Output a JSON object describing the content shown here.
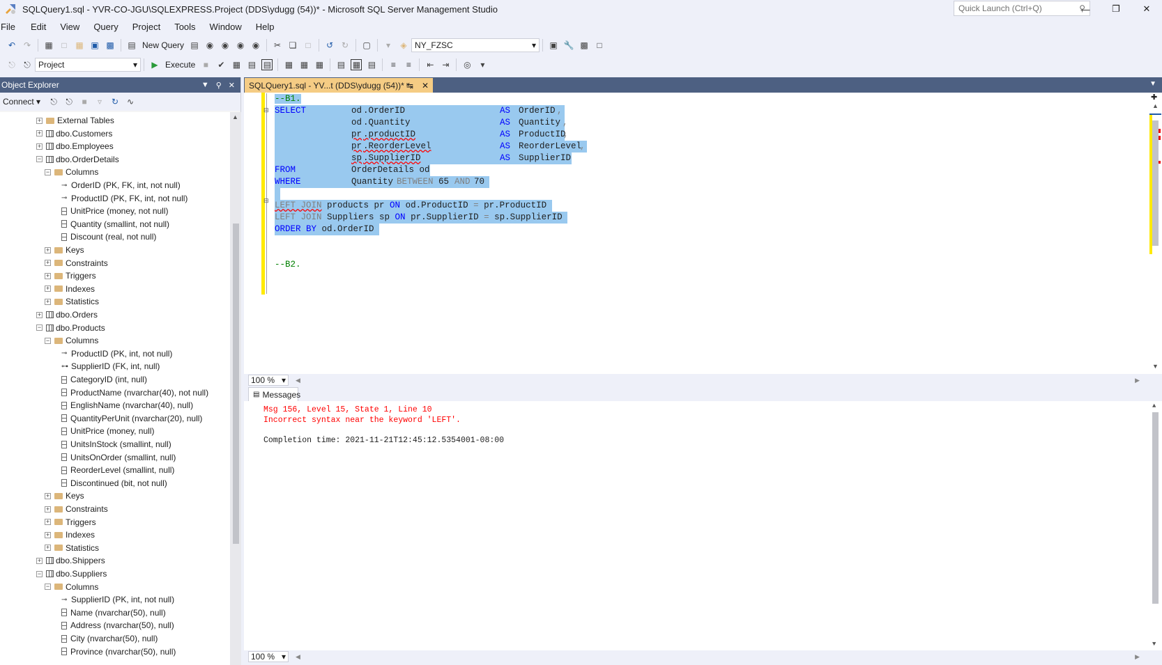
{
  "window": {
    "title": "SQLQuery1.sql - YVR-CO-JGU\\SQLEXPRESS.Project (DDS\\ydugg (54))* - Microsoft SQL Server Management Studio",
    "quick_launch_placeholder": "Quick Launch (Ctrl+Q)"
  },
  "menu": [
    "File",
    "Edit",
    "View",
    "Query",
    "Project",
    "Tools",
    "Window",
    "Help"
  ],
  "toolbar": {
    "new_query_label": "New Query",
    "connection_combo": "NY_FZSC",
    "database_combo": "Project",
    "execute_label": "Execute"
  },
  "object_explorer": {
    "title": "Object Explorer",
    "connect_label": "Connect",
    "tree": [
      {
        "label": "External Tables",
        "level": 1,
        "kind": "folder",
        "state": "+"
      },
      {
        "label": "dbo.Customers",
        "level": 1,
        "kind": "table",
        "state": "+"
      },
      {
        "label": "dbo.Employees",
        "level": 1,
        "kind": "table",
        "state": "+"
      },
      {
        "label": "dbo.OrderDetails",
        "level": 1,
        "kind": "table",
        "state": "-"
      },
      {
        "label": "Columns",
        "level": 2,
        "kind": "folder",
        "state": "-"
      },
      {
        "label": "OrderID (PK, FK, int, not null)",
        "level": 3,
        "kind": "key"
      },
      {
        "label": "ProductID (PK, FK, int, not null)",
        "level": 3,
        "kind": "key"
      },
      {
        "label": "UnitPrice (money, not null)",
        "level": 3,
        "kind": "column"
      },
      {
        "label": "Quantity (smallint, not null)",
        "level": 3,
        "kind": "column"
      },
      {
        "label": "Discount (real, not null)",
        "level": 3,
        "kind": "column"
      },
      {
        "label": "Keys",
        "level": 2,
        "kind": "folder",
        "state": "+"
      },
      {
        "label": "Constraints",
        "level": 2,
        "kind": "folder",
        "state": "+"
      },
      {
        "label": "Triggers",
        "level": 2,
        "kind": "folder",
        "state": "+"
      },
      {
        "label": "Indexes",
        "level": 2,
        "kind": "folder",
        "state": "+"
      },
      {
        "label": "Statistics",
        "level": 2,
        "kind": "folder",
        "state": "+"
      },
      {
        "label": "dbo.Orders",
        "level": 1,
        "kind": "table",
        "state": "+"
      },
      {
        "label": "dbo.Products",
        "level": 1,
        "kind": "table",
        "state": "-"
      },
      {
        "label": "Columns",
        "level": 2,
        "kind": "folder",
        "state": "-"
      },
      {
        "label": "ProductID (PK, int, not null)",
        "level": 3,
        "kind": "key"
      },
      {
        "label": "SupplierID (FK, int, null)",
        "level": 3,
        "kind": "fkey"
      },
      {
        "label": "CategoryID (int, null)",
        "level": 3,
        "kind": "column"
      },
      {
        "label": "ProductName (nvarchar(40), not null)",
        "level": 3,
        "kind": "column"
      },
      {
        "label": "EnglishName (nvarchar(40), null)",
        "level": 3,
        "kind": "column"
      },
      {
        "label": "QuantityPerUnit (nvarchar(20), null)",
        "level": 3,
        "kind": "column"
      },
      {
        "label": "UnitPrice (money, null)",
        "level": 3,
        "kind": "column"
      },
      {
        "label": "UnitsInStock (smallint, null)",
        "level": 3,
        "kind": "column"
      },
      {
        "label": "UnitsOnOrder (smallint, null)",
        "level": 3,
        "kind": "column"
      },
      {
        "label": "ReorderLevel (smallint, null)",
        "level": 3,
        "kind": "column"
      },
      {
        "label": "Discontinued (bit, not null)",
        "level": 3,
        "kind": "column"
      },
      {
        "label": "Keys",
        "level": 2,
        "kind": "folder",
        "state": "+"
      },
      {
        "label": "Constraints",
        "level": 2,
        "kind": "folder",
        "state": "+"
      },
      {
        "label": "Triggers",
        "level": 2,
        "kind": "folder",
        "state": "+"
      },
      {
        "label": "Indexes",
        "level": 2,
        "kind": "folder",
        "state": "+"
      },
      {
        "label": "Statistics",
        "level": 2,
        "kind": "folder",
        "state": "+"
      },
      {
        "label": "dbo.Shippers",
        "level": 1,
        "kind": "table",
        "state": "+"
      },
      {
        "label": "dbo.Suppliers",
        "level": 1,
        "kind": "table",
        "state": "-"
      },
      {
        "label": "Columns",
        "level": 2,
        "kind": "folder",
        "state": "-"
      },
      {
        "label": "SupplierID (PK, int, not null)",
        "level": 3,
        "kind": "key"
      },
      {
        "label": "Name (nvarchar(50), null)",
        "level": 3,
        "kind": "column"
      },
      {
        "label": "Address (nvarchar(50), null)",
        "level": 3,
        "kind": "column"
      },
      {
        "label": "City (nvarchar(50), null)",
        "level": 3,
        "kind": "column"
      },
      {
        "label": "Province (nvarchar(50), null)",
        "level": 3,
        "kind": "column"
      }
    ]
  },
  "editor": {
    "tab_title": "SQLQuery1.sql - YV...t (DDS\\ydugg (54))*",
    "zoom": "100 %",
    "code": {
      "l1": "--B1.",
      "l2a": "SELECT",
      "l2b": "od",
      "l2c": ".OrderID",
      "l2d": "AS",
      "l2e": "OrderID",
      "l3b": "od",
      "l3c": ".Quantity",
      "l3d": "AS",
      "l3e": "Quantity",
      "l4b": "pr",
      "l4c": ".productID",
      "l4d": "AS",
      "l4e": "ProductID",
      "l5b": "pr",
      "l5c": ".ReorderLevel",
      "l5d": "AS",
      "l5e": "ReorderLevel",
      "l6b": "sp",
      "l6c": ".SupplierID",
      "l6d": "AS",
      "l6e": "SupplierID",
      "l7a": "FROM",
      "l7b": "OrderDetails od",
      "l8a": "WHERE",
      "l8b": "Quantity",
      "l8c": "BETWEEN",
      "l8d": "65",
      "l8e": "AND",
      "l8f": "70",
      "l10a": "LEFT JOIN",
      "l10b": " products pr ",
      "l10c": "ON",
      "l10d": " od",
      "l10e": ".ProductID ",
      "l10f": "=",
      "l10g": " pr",
      "l10h": ".ProductID",
      "l11a": "LEFT JOIN",
      "l11b": " Suppliers sp ",
      "l11c": "ON",
      "l11d": " pr",
      "l11e": ".SupplierID ",
      "l11f": "=",
      "l11g": " sp",
      "l11h": ".SupplierID",
      "l12a": "ORDER BY",
      "l12b": " od",
      "l12c": ".OrderID",
      "l15": "--B2."
    }
  },
  "messages": {
    "tab_label": "Messages",
    "line1": "Msg 156, Level 15, State 1, Line 10",
    "line2": "Incorrect syntax near the keyword 'LEFT'.",
    "line3": "Completion time: 2021-11-21T12:45:12.5354001-08:00",
    "zoom": "100 %"
  },
  "colors": {
    "accent": "#4d6082",
    "tab": "#f5cc84",
    "selection": "#99c9ef",
    "keyword": "#0000ff",
    "error": "#ff0000",
    "comment": "#008000"
  }
}
